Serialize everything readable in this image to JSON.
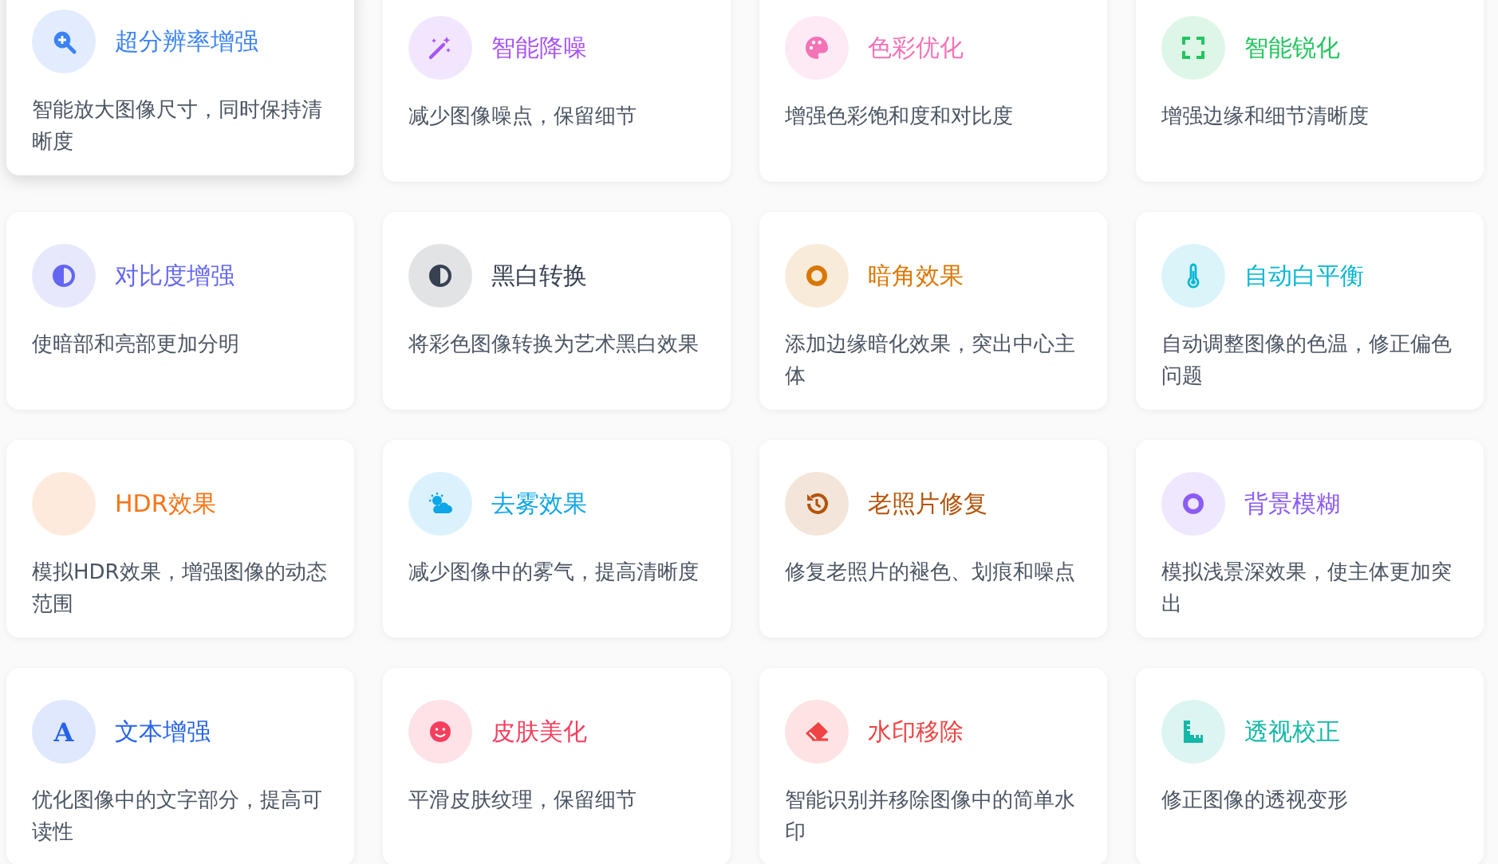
{
  "cards": [
    {
      "title": "超分辨率增强",
      "description": "智能放大图像尺寸，同时保持清晰度",
      "color": "#3b82f6",
      "highlighted": true
    },
    {
      "title": "智能降噪",
      "description": "减少图像噪点，保留细节",
      "color": "#a855f7",
      "highlighted": false
    },
    {
      "title": "色彩优化",
      "description": "增强色彩饱和度和对比度",
      "color": "#f472b6",
      "highlighted": false
    },
    {
      "title": "智能锐化",
      "description": "增强边缘和细节清晰度",
      "color": "#22c55e",
      "highlighted": false
    },
    {
      "title": "对比度增强",
      "description": "使暗部和亮部更加分明",
      "color": "#6366f1",
      "highlighted": false
    },
    {
      "title": "黑白转换",
      "description": "将彩色图像转换为艺术黑白效果",
      "color": "#374151",
      "highlighted": false
    },
    {
      "title": "暗角效果",
      "description": "添加边缘暗化效果，突出中心主体",
      "color": "#d97706",
      "highlighted": false
    },
    {
      "title": "自动白平衡",
      "description": "自动调整图像的色温，修正偏色问题",
      "color": "#06b6d4",
      "highlighted": false
    },
    {
      "title": "HDR效果",
      "description": "模拟HDR效果，增强图像的动态范围",
      "color": "#f97316",
      "highlighted": false
    },
    {
      "title": "去雾效果",
      "description": "减少图像中的雾气，提高清晰度",
      "color": "#0ea5e9",
      "highlighted": false
    },
    {
      "title": "老照片修复",
      "description": "修复老照片的褪色、划痕和噪点",
      "color": "#b45309",
      "highlighted": false
    },
    {
      "title": "背景模糊",
      "description": "模拟浅景深效果，使主体更加突出",
      "color": "#8b5cf6",
      "highlighted": false
    },
    {
      "title": "文本增强",
      "description": "优化图像中的文字部分，提高可读性",
      "glyph": "A",
      "color": "#2563eb",
      "highlighted": false
    },
    {
      "title": "皮肤美化",
      "description": "平滑皮肤纹理，保留细节",
      "color": "#f43f5e",
      "highlighted": false
    },
    {
      "title": "水印移除",
      "description": "智能识别并移除图像中的简单水印",
      "color": "#ef4444",
      "highlighted": false
    },
    {
      "title": "透视校正",
      "description": "修正图像的透视变形",
      "color": "#14b8a6",
      "highlighted": false
    }
  ]
}
